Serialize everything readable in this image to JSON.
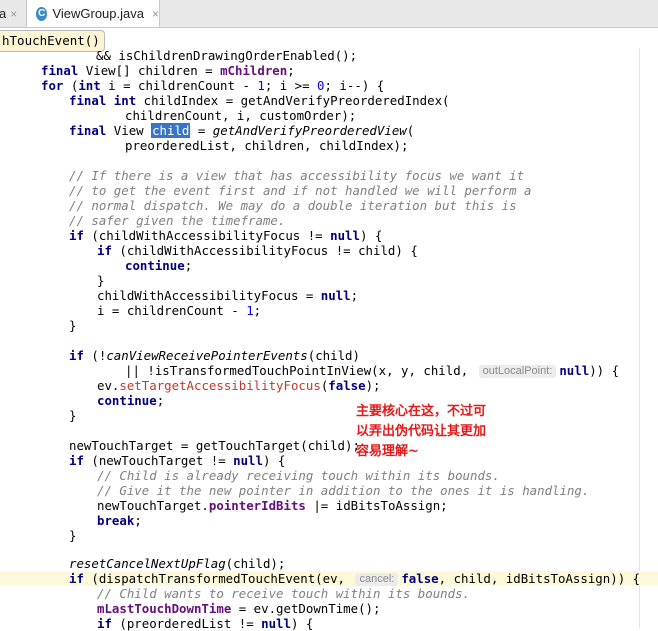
{
  "tabs": {
    "prev_label": "a",
    "prev_close": "×",
    "active_icon": "C",
    "active_label": "ViewGroup.java",
    "active_close": "×"
  },
  "breadcrumb": "hTouchEvent()",
  "code": {
    "l00": "&& isChildrenDrawingOrderEnabled();",
    "l01_kw": "final",
    "l01_a": " View[] children = ",
    "l01_fld": "mChildren",
    "l01_b": ";",
    "l02_kw1": "for",
    "l02_a": " (",
    "l02_kw2": "int",
    "l02_b": " i = childrenCount - ",
    "l02_n1": "1",
    "l02_c": "; i >= ",
    "l02_n2": "0",
    "l02_d": "; i--) {",
    "l03_kw1": "final",
    "l03_a": " ",
    "l03_kw2": "int",
    "l03_b": " childIndex = getAndVerifyPreorderedIndex(",
    "l04": "childrenCount, i, customOrder);",
    "l05_kw": "final",
    "l05_a": " View ",
    "l05_sel": "child",
    "l05_b": " = ",
    "l05_it": "getAndVerifyPreorderedView",
    "l05_c": "(",
    "l06": "preorderedList, children, childIndex);",
    "l08": "// If there is a view that has accessibility focus we want it",
    "l09": "// to get the event first and if not handled we will perform a",
    "l10": "// normal dispatch. We may do a double iteration but this is",
    "l11": "// safer given the timeframe.",
    "l12_kw1": "if",
    "l12_a": " (childWithAccessibilityFocus != ",
    "l12_kw2": "null",
    "l12_b": ") {",
    "l13_kw": "if",
    "l13_a": " (childWithAccessibilityFocus != child) {",
    "l14_kw": "continue",
    "l14_a": ";",
    "l15": "}",
    "l16_a": "childWithAccessibilityFocus = ",
    "l16_kw": "null",
    "l16_b": ";",
    "l17_a": "i = childrenCount - ",
    "l17_n": "1",
    "l17_b": ";",
    "l18": "}",
    "l20_kw": "if",
    "l20_a": " (!",
    "l20_it": "canViewReceivePointerEvents",
    "l20_b": "(child)",
    "l21_a": "|| !isTransformedTouchPointInView(x, y, child, ",
    "l21_hint": "outLocalPoint:",
    "l21_kw": "null",
    "l21_b": ")) {",
    "l22_a": "ev.",
    "l22_err": "setTargetAccessibilityFocus",
    "l22_b": "(",
    "l22_kw": "false",
    "l22_c": ");",
    "l23_kw": "continue",
    "l23_a": ";",
    "l24": "}",
    "l26": "newTouchTarget = getTouchTarget(child);",
    "l27_kw1": "if",
    "l27_a": " (newTouchTarget != ",
    "l27_kw2": "null",
    "l27_b": ") {",
    "l28": "// Child is already receiving touch within its bounds.",
    "l29": "// Give it the new pointer in addition to the ones it is handling.",
    "l30_a": "newTouchTarget.",
    "l30_fld": "pointerIdBits",
    "l30_b": " |= idBitsToAssign;",
    "l31_kw": "break",
    "l31_a": ";",
    "l32": "}",
    "l34_it": "resetCancelNextUpFlag",
    "l34_a": "(child);",
    "l35_kw1": "if",
    "l35_a": " (dispatchTransformedTouchEvent(ev, ",
    "l35_hint": "cancel:",
    "l35_kw2": "false",
    "l35_b": ", child, idBitsToAssign)) {",
    "l36": "// Child wants to receive touch within its bounds.",
    "l37_fld": "mLastTouchDownTime",
    "l37_a": " = ev.getDownTime();",
    "l38_kw1": "if",
    "l38_a": " (preorderedList != ",
    "l38_kw2": "null",
    "l38_b": ") {"
  },
  "annotation": {
    "line1": "主要核心在这，不过可",
    "line2": "以弄出伪代码让其更加",
    "line3": "容易理解~"
  },
  "colors": {
    "keyword": "#000080",
    "field": "#660e7a",
    "number": "#0000ff",
    "comment": "#808080",
    "annotation": "#e21a1a",
    "selection": "#3874c8",
    "current_line": "#fcfad9"
  }
}
